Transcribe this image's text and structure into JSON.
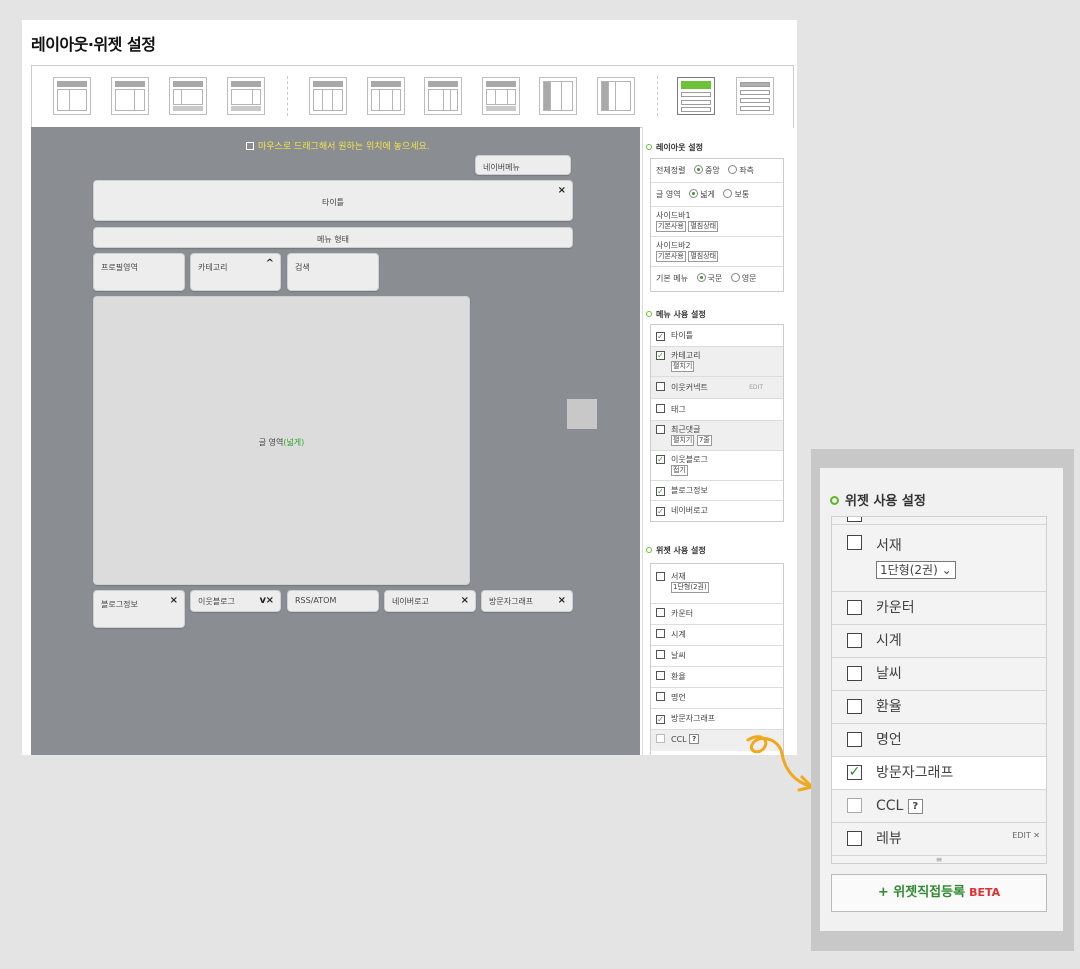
{
  "page_title": "레이아웃·위젯 설정",
  "canvas": {
    "drag_hint": "마우스로 드래그해서 원하는 위치에 놓으세요.",
    "naver_menu": "네이버메뉴",
    "title_box": "타이틀",
    "menu_box": "메뉴 형태",
    "profile_box": "프로필영역",
    "category_box": "카테고리",
    "search_box": "검색",
    "content_label": "글 영역",
    "content_suffix": "(넓게)",
    "blog_info": "블로그정보",
    "neighbor_blog": "이웃블로그",
    "rss": "RSS/ATOM",
    "naver_logo": "네이버로고",
    "visitor_graph": "방문자그래프",
    "close_x": "×",
    "caret_up": "^",
    "caret_down": "v"
  },
  "layout_settings": {
    "title": "레이아웃 설정",
    "align_label": "전체정렬",
    "align_center": "중앙",
    "align_left": "좌측",
    "text_area_label": "글 영역",
    "text_wide": "넓게",
    "text_normal": "보통",
    "sidebar1": "사이드바1",
    "sidebar2": "사이드바2",
    "sidebar_select_a": "기본사용",
    "sidebar_select_b": "펼침상태",
    "basic_menu_label": "기본 메뉴",
    "menu_korean": "국문",
    "menu_english": "영문"
  },
  "menu_settings": {
    "title": "메뉴 사용 설정",
    "items": [
      {
        "label": "타이틀",
        "checked": true
      },
      {
        "label": "카테고리",
        "checked": true,
        "select": "펼치기"
      },
      {
        "label": "이웃커넥트",
        "checked": false,
        "edit": "EDIT"
      },
      {
        "label": "태그",
        "checked": false
      },
      {
        "label": "최근댓글",
        "checked": false,
        "select": "펼치기",
        "select2": "7줄"
      },
      {
        "label": "이웃블로그",
        "checked": true,
        "select": "접기"
      },
      {
        "label": "블로그정보",
        "checked": true
      },
      {
        "label": "네이버로고",
        "checked": true
      }
    ]
  },
  "widget_settings": {
    "title": "위젯 사용 설정",
    "items": [
      {
        "label": "서재",
        "checked": false,
        "select": "1단형(2권)"
      },
      {
        "label": "카운터",
        "checked": false
      },
      {
        "label": "시계",
        "checked": false
      },
      {
        "label": "날씨",
        "checked": false
      },
      {
        "label": "환율",
        "checked": false
      },
      {
        "label": "명언",
        "checked": false
      },
      {
        "label": "방문자그래프",
        "checked": true
      },
      {
        "label": "CCL",
        "checked": false,
        "help": "?"
      }
    ]
  },
  "zoom_panel": {
    "title": "위젯 사용 설정",
    "items": [
      {
        "label": "서재",
        "checked": false,
        "select": "1단형(2권)"
      },
      {
        "label": "카운터",
        "checked": false
      },
      {
        "label": "시계",
        "checked": false
      },
      {
        "label": "날씨",
        "checked": false
      },
      {
        "label": "환율",
        "checked": false
      },
      {
        "label": "명언",
        "checked": false
      },
      {
        "label": "방문자그래프",
        "checked": true
      },
      {
        "label": "CCL",
        "checked": false,
        "help": "?"
      },
      {
        "label": "레뷰",
        "checked": false,
        "edit": "EDIT"
      }
    ],
    "register_button": "+ 위젯직접등록",
    "beta": "BETA"
  },
  "colors": {
    "accent_green": "#6cc23a",
    "annotation_arrow": "#f0a81c",
    "canvas_bg": "#8a8d92"
  }
}
